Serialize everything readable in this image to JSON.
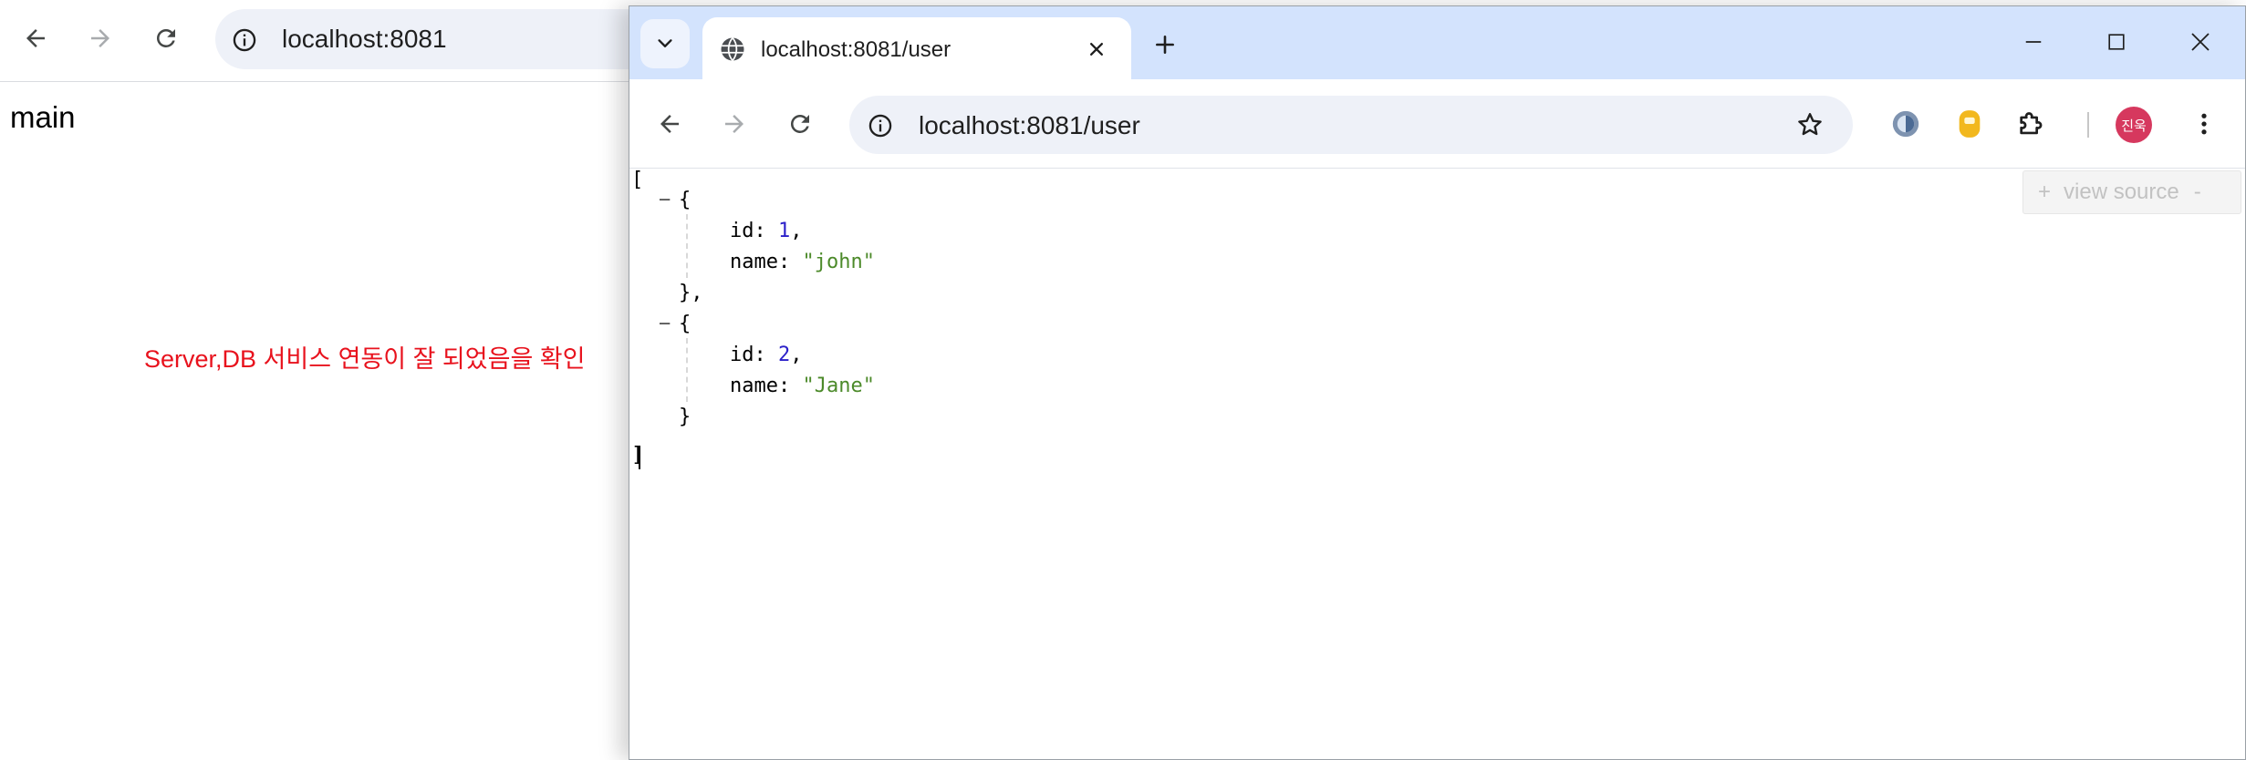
{
  "background_browser": {
    "url": "localhost:8081",
    "page_text": "main",
    "icons": {
      "back": "arrow-left-icon",
      "forward": "arrow-right-icon",
      "reload": "reload-icon",
      "site_info": "info-icon"
    }
  },
  "annotation": {
    "text": "Server,DB 서비스 연동이 잘 되었음을 확인",
    "color": "#e8121d"
  },
  "window": {
    "tab": {
      "title": "localhost:8081/user",
      "favicon": "globe-icon"
    },
    "omnibox": {
      "url": "localhost:8081/user"
    },
    "profile": {
      "initials": "진욱",
      "color": "#d6385e"
    },
    "icons": {
      "tab_search": "chevron-down-icon",
      "new_tab": "plus-icon",
      "minimize": "minimize-icon",
      "maximize": "maximize-icon",
      "close": "close-icon",
      "bookmark": "star-icon",
      "extension_1": "circle-logo-icon",
      "extension_2": "yellow-extension-icon",
      "extensions_menu": "puzzle-icon",
      "menu": "kebab-menu-icon"
    }
  },
  "json_viewer": {
    "view_source": {
      "plus": "+",
      "label": "view source",
      "minus": "-"
    },
    "open_bracket": "[",
    "close_bracket": "]",
    "items": [
      {
        "open": "{",
        "id_key": "id",
        "id_value": "1",
        "name_key": "name",
        "name_value": "\"john\"",
        "close": "},",
        "collapser": "−"
      },
      {
        "open": "{",
        "id_key": "id",
        "id_value": "2",
        "name_key": "name",
        "name_value": "\"Jane\"",
        "close": "}",
        "collapser": "−"
      }
    ],
    "colors": {
      "number": "#2b20c9",
      "string": "#4c8a2a"
    }
  }
}
